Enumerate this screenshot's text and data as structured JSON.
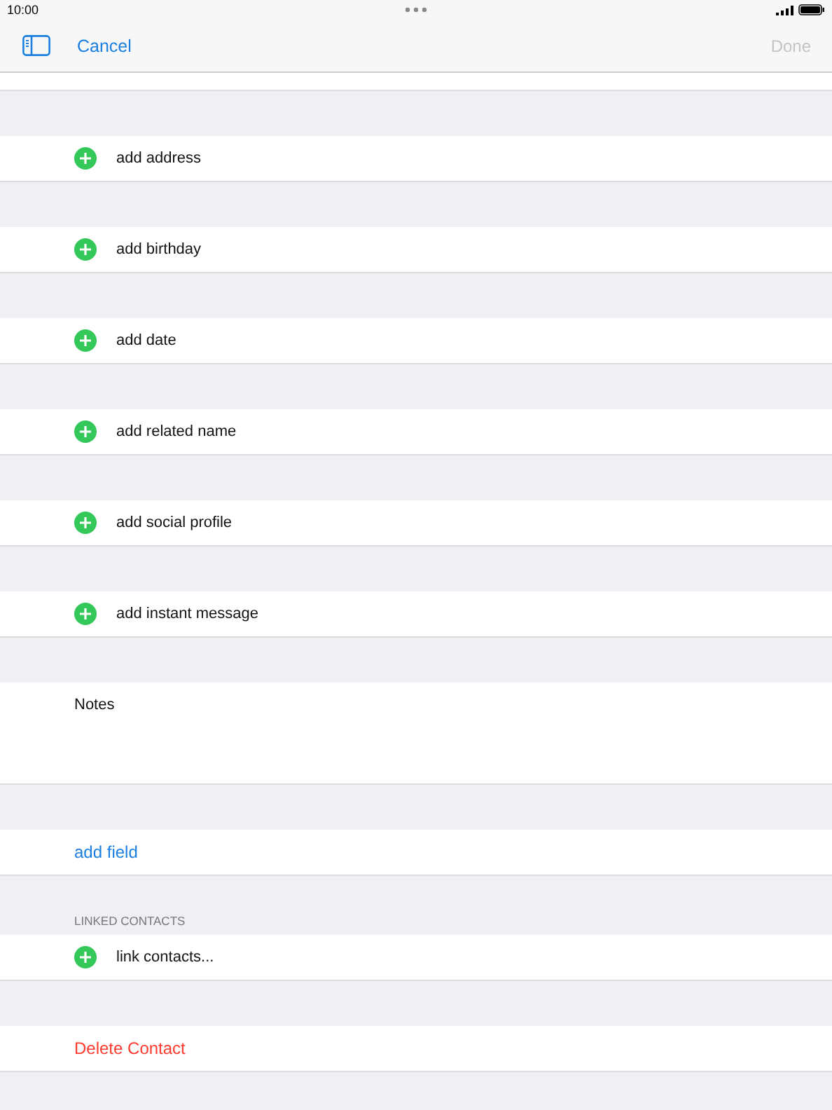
{
  "status_bar": {
    "time": "10:00"
  },
  "nav": {
    "cancel": "Cancel",
    "done": "Done",
    "done_disabled": true
  },
  "sections": [
    {
      "kind": "add",
      "label": "add address"
    },
    {
      "kind": "add",
      "label": "add birthday"
    },
    {
      "kind": "add",
      "label": "add date"
    },
    {
      "kind": "add",
      "label": "add related name"
    },
    {
      "kind": "add",
      "label": "add social profile"
    },
    {
      "kind": "add",
      "label": "add instant message"
    },
    {
      "kind": "notes",
      "label": "Notes"
    },
    {
      "kind": "link",
      "label": "add field"
    },
    {
      "kind": "add",
      "label": "link contacts...",
      "header": "LINKED CONTACTS"
    },
    {
      "kind": "delete",
      "label": "Delete Contact"
    }
  ]
}
